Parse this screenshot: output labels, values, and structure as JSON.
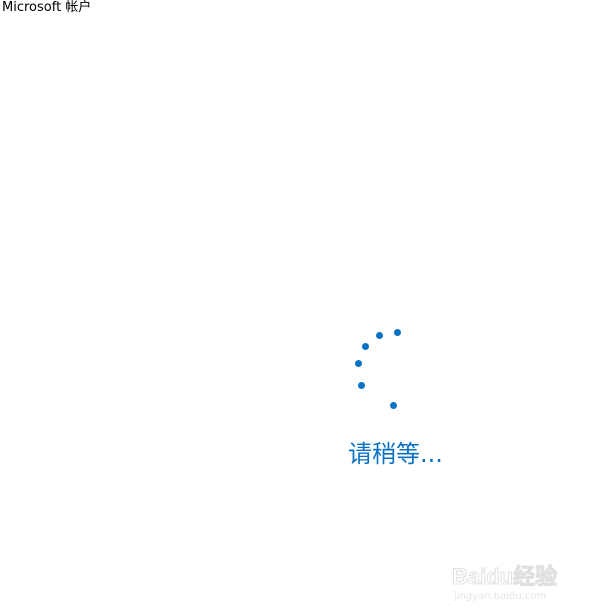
{
  "window": {
    "title": "Microsoft 帐户"
  },
  "loading": {
    "text": "请稍等...",
    "spinner_icon": "loading-dots-icon"
  },
  "colors": {
    "accent": "#0a72c4",
    "text_dark": "#000000",
    "background": "#ffffff"
  },
  "watermark": {
    "logo_text": "Baidu经验",
    "sub_text": "jingyan.baidu.com"
  }
}
